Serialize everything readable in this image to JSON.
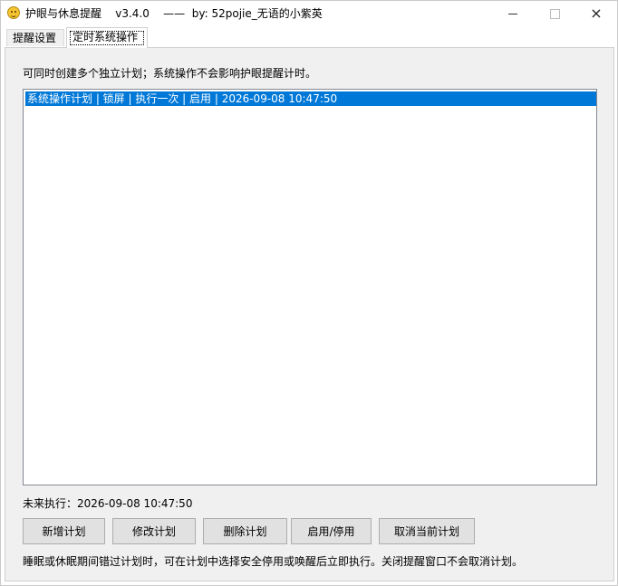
{
  "window": {
    "title": "护眼与休息提醒    v3.4.0    ——  by: 52pojie_无语的小紫英",
    "controls": {
      "minimize": "minimize-icon",
      "maximize": "maximize-icon",
      "close": "×"
    }
  },
  "tabs": [
    {
      "label": "提醒设置",
      "selected": false
    },
    {
      "label": "定时系统操作",
      "selected": true
    }
  ],
  "scheduler": {
    "hint_top": "可同时创建多个独立计划；系统操作不会影响护眼提醒计时。",
    "plans": [
      {
        "text": "系统操作计划 | 锁屏 | 执行一次 | 启用 | 2026-09-08 10:47:50",
        "selected": true
      }
    ],
    "next_run": "未来执行：2026-09-08 10:47:50",
    "buttons": {
      "add": "新增计划",
      "edit": "修改计划",
      "delete": "删除计划",
      "toggle": "启用/停用",
      "cancel_current": "取消当前计划"
    },
    "hint_bottom": "睡眠或休眠期间错过计划时，可在计划中选择安全停用或唤醒后立即执行。关闭提醒窗口不会取消计划。"
  },
  "colors": {
    "selection": "#0078d7",
    "panel": "#f0f0f0",
    "button": "#e1e1e1"
  }
}
